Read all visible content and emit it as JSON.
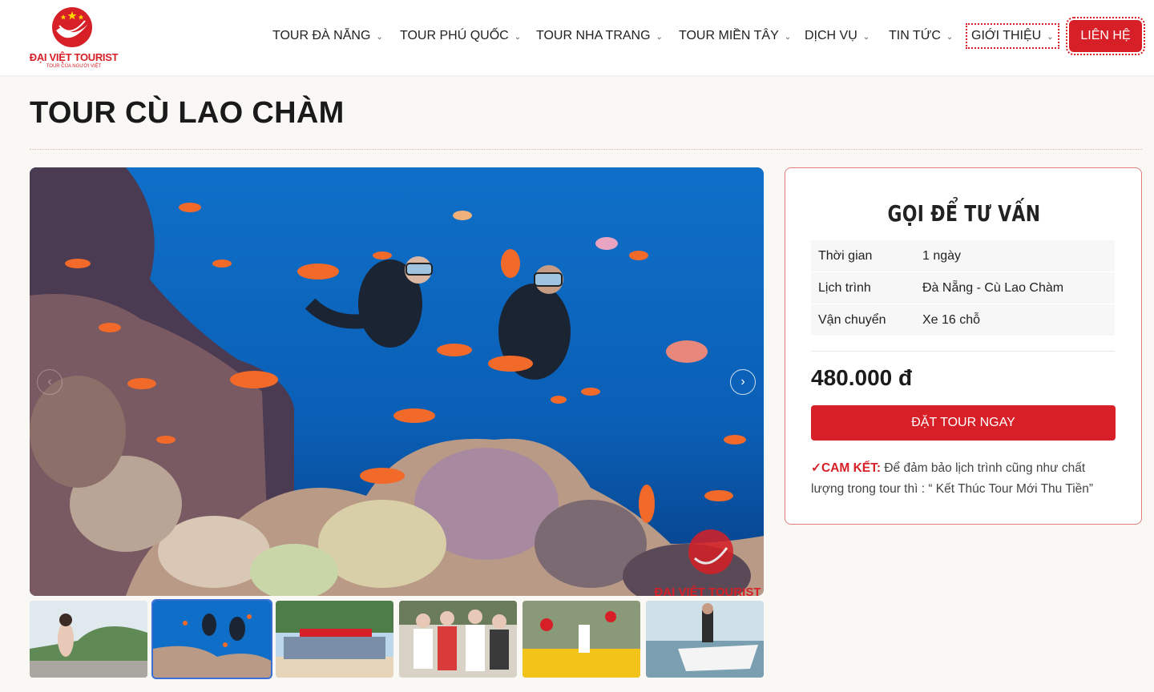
{
  "header": {
    "logo_brand": "ĐẠI VIỆT TOURIST",
    "logo_tagline": "TOUR CỦA NGƯỜI VIỆT",
    "nav": [
      {
        "label": "TOUR ĐÀ NẴNG"
      },
      {
        "label": "TOUR PHÚ QUỐC"
      },
      {
        "label": "TOUR NHA TRANG"
      },
      {
        "label": "TOUR MIỀN TÂY"
      },
      {
        "label": "DỊCH VỤ"
      },
      {
        "label": "TIN TỨC"
      },
      {
        "label": "GIỚI THIỆU"
      }
    ],
    "contact_label": "LIÊN HỆ"
  },
  "page": {
    "title": "TOUR CÙ LAO CHÀM"
  },
  "gallery": {
    "main_image": "scuba-divers-coral-reef",
    "watermark": "ĐẠI VIỆT TOURIST",
    "thumbnails": [
      "woman-on-boat-island",
      "scuba-divers-coral-reef",
      "group-photo-beach-banner",
      "group-family-tour",
      "flower-market-street",
      "boarding-speedboat"
    ],
    "active_index": 1
  },
  "sidebar": {
    "title": "GỌI ĐỂ TƯ VẤN",
    "info": [
      {
        "key": "Thời gian",
        "value": "1 ngày"
      },
      {
        "key": "Lịch trình",
        "value": "Đà Nẵng - Cù Lao Chàm"
      },
      {
        "key": "Vận chuyển",
        "value": "Xe 16 chỗ"
      }
    ],
    "price": "480.000 đ",
    "book_label": "ĐẶT TOUR NGAY",
    "commit_label": "✓CAM KẾT:",
    "commit_text": " Để đảm bảo lịch trình cũng như chất lượng trong tour thì : “ Kết Thúc Tour Mới Thu Tiền”"
  },
  "colors": {
    "accent": "#d61f26",
    "background": "#faf8f5"
  }
}
